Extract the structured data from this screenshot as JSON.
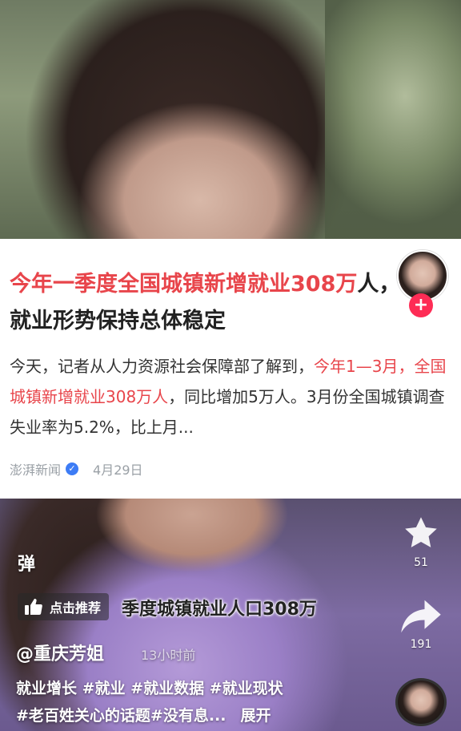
{
  "news_card": {
    "headline_highlight": "今年一季度全国城镇新增就业308万",
    "headline_rest": "人，就业形势保持总体稳定",
    "summary_part1": "今天，记者从人力资源社会保障部了解到，",
    "summary_highlight": "今年1—3月，全国城镇新增就业308万人",
    "summary_part2": "，同比增加5万人。3月份全国城镇调查失业率为5.2%，比上月...",
    "source": "澎湃新闻",
    "date": "4月29日"
  },
  "follow_button": {
    "label": "+"
  },
  "actions": {
    "like_count": "51",
    "share_count": "191"
  },
  "danmaku_toggle": {
    "label": "弹"
  },
  "recommend": {
    "label": "点击推荐"
  },
  "subtitle": {
    "text": "季度城镇就业人口308万"
  },
  "author": {
    "name": "@重庆芳姐",
    "time": "13小时前"
  },
  "description": {
    "line1": "就业增长 #就业 #就业数据 #就业现状",
    "line2": "#老百姓关心的话题#没有息...",
    "expand": "展开"
  },
  "colors": {
    "highlight_red": "#e8454b",
    "follow_red": "#fe2c55",
    "verified_blue": "#3d7cf5"
  },
  "icons": {
    "like": "star-icon",
    "share": "share-arrow-icon",
    "recommend": "thumb-up-icon",
    "verified": "verified-check-icon"
  }
}
